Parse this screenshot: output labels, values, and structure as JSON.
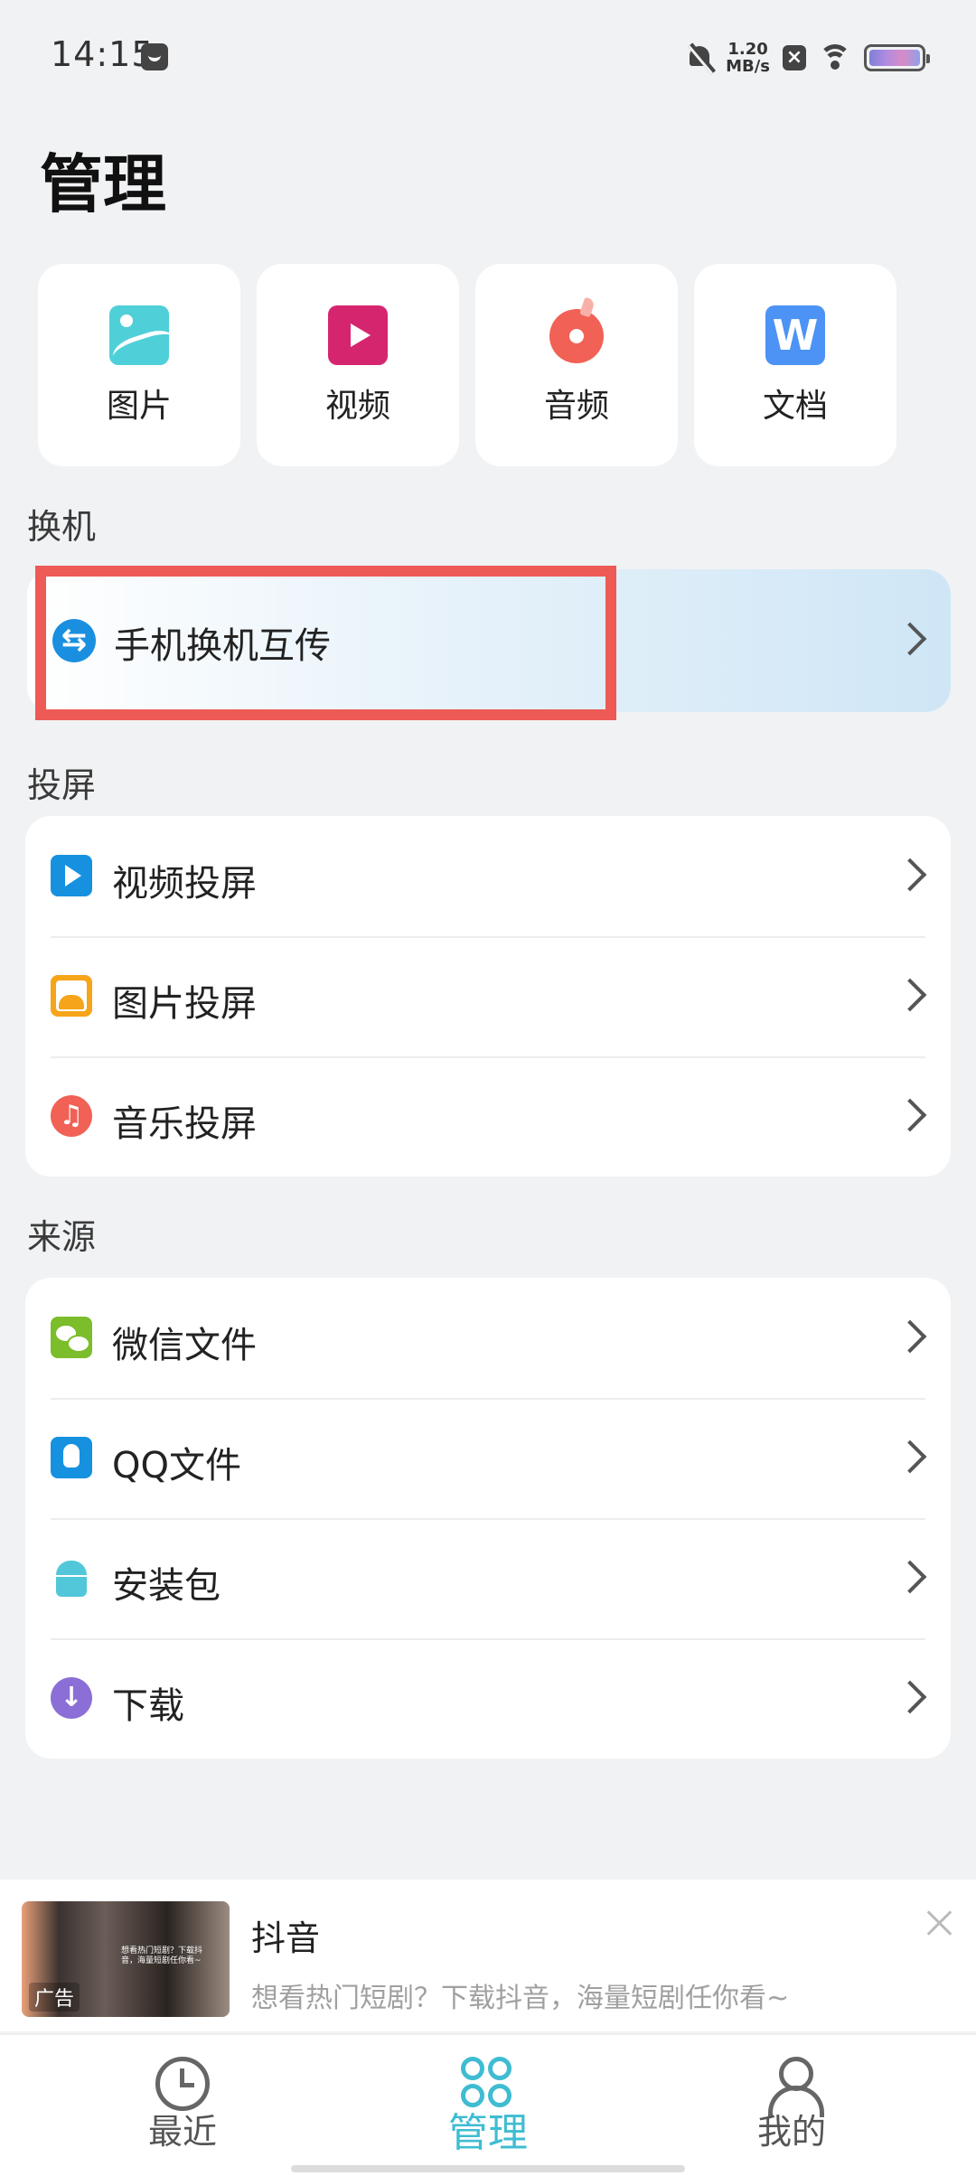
{
  "status_bar": {
    "time": "14:15",
    "net_speed_value": "1.20",
    "net_speed_unit": "MB/s"
  },
  "page": {
    "title": "管理"
  },
  "categories": [
    {
      "label": "图片",
      "icon": "image-icon"
    },
    {
      "label": "视频",
      "icon": "video-icon"
    },
    {
      "label": "音频",
      "icon": "audio-icon"
    },
    {
      "label": "文档",
      "icon": "document-icon",
      "glyph": "W"
    }
  ],
  "switch_section": {
    "label": "换机",
    "item": {
      "label": "手机换机互传",
      "icon": "transfer-icon"
    }
  },
  "cast_section": {
    "label": "投屏",
    "items": [
      {
        "label": "视频投屏",
        "icon": "video-cast-icon"
      },
      {
        "label": "图片投屏",
        "icon": "image-cast-icon"
      },
      {
        "label": "音乐投屏",
        "icon": "music-cast-icon",
        "glyph": "♫"
      }
    ]
  },
  "source_section": {
    "label": "来源",
    "items": [
      {
        "label": "微信文件",
        "icon": "wechat-icon"
      },
      {
        "label": "QQ文件",
        "icon": "qq-icon"
      },
      {
        "label": "安装包",
        "icon": "android-icon"
      },
      {
        "label": "下载",
        "icon": "download-icon",
        "glyph": "↓"
      }
    ]
  },
  "ad": {
    "title": "抖音",
    "description": "想看热门短剧？下载抖音，海量短剧任你看~",
    "tag": "广告",
    "thumb_text": "想看热门短剧？下载抖音，海量短剧任你看~"
  },
  "bottom_nav": {
    "items": [
      {
        "label": "最近",
        "icon": "clock-icon"
      },
      {
        "label": "管理",
        "icon": "manage-icon",
        "active": true
      },
      {
        "label": "我的",
        "icon": "person-icon"
      }
    ]
  },
  "colors": {
    "accent": "#3fbcd2",
    "highlight_border": "#ee5a55",
    "background": "#f1f2f4"
  }
}
